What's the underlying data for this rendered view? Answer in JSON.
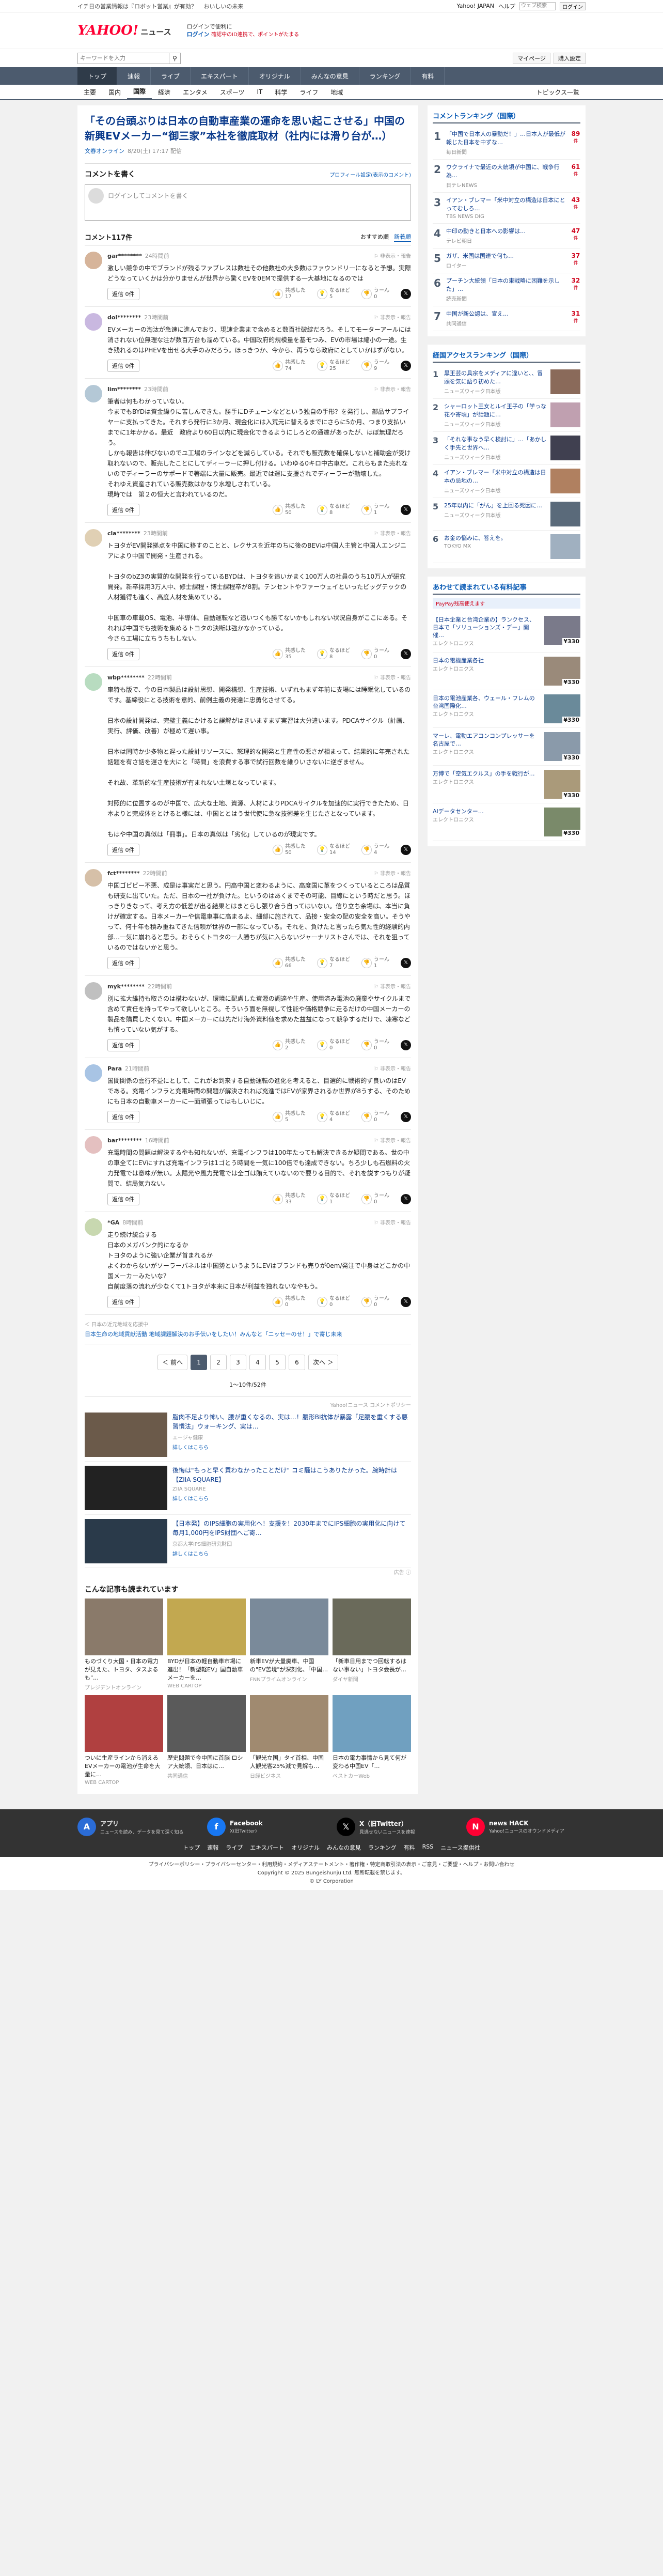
{
  "topstrip": {
    "links": [
      "イチ日の営業情報は『ロボット営業』が有効？",
      "おいしいの未来"
    ],
    "right_links": [
      "Yahoo! JAPAN",
      "ヘルプ"
    ],
    "search_placeholder": "ウェブ検索",
    "search_button": "ログイン"
  },
  "header": {
    "logo": "YAHOO!",
    "logo_sub": "ニュース",
    "promo": "ログインで便利に",
    "promo2": "ニュースをもっと楽しく",
    "login": "ログイン",
    "sub": "確認中のID連携で、ポイントがたまる"
  },
  "search": {
    "placeholder": "キーワードを入力",
    "buttons": [
      "マイページ",
      "購入設定"
    ]
  },
  "gnav": [
    "トップ",
    "速報",
    "ライブ",
    "エキスパート",
    "オリジナル",
    "みんなの意見",
    "ランキング",
    "有料"
  ],
  "snav": [
    "主要",
    "国内",
    "国際",
    "経済",
    "エンタメ",
    "スポーツ",
    "IT",
    "科学",
    "ライフ",
    "地域"
  ],
  "snav_right": "トピックス一覧",
  "article": {
    "title": "「その台頭ぶりは日本の自動車産業の運命を思い起こさせる」中国の新興EVメーカー“御三家”本社を徹底取材（社内には滑り台が…）",
    "source": "文春オンライン",
    "date": "8/20(土) 17:17 配信"
  },
  "comment_form": {
    "title": "コメントを書く",
    "policy": "プロフィール設定(表示のコメント)",
    "placeholder": "ログインしてコメントを書く"
  },
  "comments_header": {
    "count": "コメント117件",
    "sort": [
      "おすすめ順",
      "新着順"
    ]
  },
  "comments": [
    {
      "user": "gar********",
      "time": "24時間前",
      "text": "激しい競争の中でブランドが残るファブレスは数社その他数社の大多数はファウンドリーになると予想。実際どうなっていくかは分かりませんが世界から驚くEVを0EMで提供する一大基地になるのでは",
      "replies": "返信 0件",
      "likes": "17",
      "dislikes": "5",
      "good": "0"
    },
    {
      "user": "dol********",
      "time": "23時間前",
      "text": "EVメーカーの淘汰が急速に進んでおり、現速企業まで含めると数百社破綻だろう。そしてモーターアールには消されない位無理な注が数百万台も溜めている。中国政府的規模量を基モつみ、EVの市場は縮小の一途。生き残れるのはPHEVを出せる大手のみだろう。ほっきつか、今から、再うなら政府にとしていかはずがない。",
      "replies": "返信 0件",
      "likes": "74",
      "dislikes": "25",
      "good": "9"
    },
    {
      "user": "lim********",
      "time": "23時間前",
      "text": "筆者は何もわかっていない。\n今までもBYDは資金繰りに苦しんできた。勝手にDチェーンなどという独自の手形？を発行し、部品サプライヤーに支払ってきた。それすら発行に3か月、現金化には入荒元に替えるまでにさらに5か月、つまり支払いまでに1年かかる。最近　政府より60日以内に現金化できるようにしろとの通達があったが、はぼ無理だろう。\nしかも報告は伸びないのでユ工場のラインなどを減らしている。それでも販売数を確保しないと補助金が受け取れないので、販売したことにしてディーラーに押し付ける。いわゆる0キロ中古車だ。これらもまた売れないのでディーラーのサポ一ドで著端に大量に販売。最近では運に支援されでディーラーが勤壊した。\nそれゆえ資産されている販売数はかなり水増しされている。\n現時では　第２の恒大と言われているのだ。",
      "replies": "返信 0件",
      "likes": "50",
      "dislikes": "8",
      "good": "1"
    },
    {
      "user": "cla********",
      "time": "23時間前",
      "text": "トヨタがEV開発拠点を中国に移すのことと、レクサスを近年のちに後のBEVは中国人主管と中国人エンジニアにより中国で開発・生産される。\n\nトヨタのbZ3の実質的な開発を行っているBYDは、トヨタを追いかまく100万人の社員のうち10万人が研究開発。新卒採用3万人中、修士課程・博士課程卒が8割。テンセントやファーウェイといったビッグテックの人材獲得も進く、高度人材を集めている。\n\n中国車の車載OS、電池、半導体、自動運転など追いつくも勝てないかもしれない状況自身がここにある。それれば中国でも技術を集めるトヨタの決断は強かなかっている。\n今さら工場に立ちうちもしない。",
      "replies": "返信 0件",
      "likes": "35",
      "dislikes": "8",
      "good": "0"
    },
    {
      "user": "wbp********",
      "time": "22時間前",
      "text": "車特も版で、今の日本製品は設計思想、開発構想、生産技術、いずれもまず年前に支場には睡眠化しているのです。基締役にとる技術を意的、前例主義の発達に忠勇化させてる。\n\n日本の設計開発は、完璧主義にかけると誤解がはきいますまず実習は大分違います。PDCAサイクル（計画、実行、評価、改善）が極めて遅い事。\n\n日本は同時か少多物と遅った設計リソースに、怒理的な開発と生産性の悪さが相まって、結果的に年売された話題を有さ話を遅さを大にと「時間」を浪費する事で試行回数を維りいさないに逆ぎません。\n\nそれ故、革新的な生産技術が有まれない土壌となっています。\n\n対照的に位置するのが中国で、広大な土地、資源、人材によりPDCAサイクルを加速的に実行できたため、日本よりと完成体をとけると様には、中国ととはう世代使に急な技術差を生じたさとなっています。\n\nもはや中国の真似は「冊事」。日本の真似は「劣化」しているのが現実です。",
      "replies": "返信 0件",
      "likes": "50",
      "dislikes": "14",
      "good": "4"
    },
    {
      "user": "fct********",
      "time": "22時間前",
      "text": "中国ゴビビー不悪、成是は事実だと思う。円高中国と変わるように、高度国に革をつくっているところは品質も研支に出ていた。ただ、日本の一社が負けた。というのはあくまでその可能、目線にという時だと思う。ほっきりきなって、考え方の低差が出る結果とはまとらし張り合う自ってはいない。信り立ち余場は、本当に負けが確定する。日本メーカーや信電車事に高まるよ、細部に施されて、品接・安全の配の安全を高い。そうやって、何十年も積み重ねてきた信頼が世界の一部になっている。それを、負けたと言ったら気た性的経験的内部…一気に崩れると思う。おそらくトヨタの一人勝ちが気に入らないジャーナリストさんでは、それを狙っているのではないかと思う。",
      "replies": "返信 0件",
      "likes": "66",
      "dislikes": "7",
      "good": "1"
    },
    {
      "user": "myk********",
      "time": "22時間前",
      "text": "別に拡大維持も取さのは構わないが、環境に配慮した資源の調達や生産。使用済み電池の廃棄やサイクルまで含めて責任を持ってやって欲しいところ。そういう面を無視して性能や価格競争に走るだけの中国メーカーの製品を購買したくない。中国メーカーには先だけ海外資料値を求めた益益になって競争するだけで、凍寒なども慎っていない気がする。",
      "replies": "返信 0件",
      "likes": "2",
      "dislikes": "0",
      "good": "0"
    },
    {
      "user": "Para",
      "time": "21時間前",
      "text": "国間関係の雲行不益にとして、これがお到来する自動運転の進化を考えると、目選的に戦術的ず良いのはEVである。充電インフラと充電時間の問題が解決されれば充進ではEVが家界されるか世界が8うする、そのためにも日本の自動車メーカーに一面頑張ってはもしいじに。",
      "replies": "返信 0件",
      "likes": "5",
      "dislikes": "4",
      "good": "0"
    },
    {
      "user": "bar********",
      "time": "16時間前",
      "text": "充電時間の問題は解決するやも知れないが、充電インフラは100年たっても解決できるか疑問である。世の中の車全てにEVにすれば充電インフラは1ゴとう時間を一気に100倍でも達成できない。ちろ少しも石燃料の火力発電では意味が無い。太陽光や風力発電では全ゴは賄えていないので要りる目的で、それを説すつもりが疑問で、結局気力ない。",
      "replies": "返信 0件",
      "likes": "33",
      "dislikes": "1",
      "good": "0"
    },
    {
      "user": "*GA",
      "time": "8時間前",
      "text": "走り続け統合する\n日本のメガバンク的になるか\nトヨタのように強い企業が首まれるか\nよくわからないがソーラーパネルは中国勢というようにEVはブランドも売りが0em/発注で中身はどこかの中国メーカーみたいな？\n自前度落の流れが少なくて1トヨタが本来に日本が利益を独れないなやもう。",
      "replies": "返信 0件",
      "likes": "0",
      "dislikes": "0",
      "good": "0"
    }
  ],
  "sponsored_comment": {
    "label": "＜ 日本の近元地域を応援中",
    "text": "日本生命の地域貢献活動 地域課題解決のお手伝いをしたい！みんなと「ニッセーのせ！」で寄じ未来"
  },
  "pager": {
    "prev": "＜ 前へ",
    "pages": [
      "1",
      "2",
      "3",
      "4",
      "5",
      "6"
    ],
    "next": "次へ ＞",
    "count": "1〜10件/52件"
  },
  "ads": {
    "label": "Yahoo!ニュース コメントポリシー",
    "items": [
      {
        "text": "脂肉不足より怖い、腰が重くなるの、実は…！腰形BI抗体が暴露「足腰を重くする悪習慣法」ウォーキング、実は…",
        "sponsor": "エージャ健康",
        "more": "詳しくはこちら"
      },
      {
        "text": "後悔は\"もっと早く買わなかったことだけ\" コミ騒はこうありたかった。腕時計は【ZIIA SQUARE】",
        "sponsor": "ZIIA SQUARE",
        "more": "詳しくはこちら"
      },
      {
        "text": "【日本発】のIPS細胞の実用化へ！支援を！2030年までにIPS細胞の実用化に向けて毎月1,000円をIPS財団へご寄…",
        "sponsor": "京都大学iPS細胞研究財団",
        "more": "詳しくはこちら"
      }
    ]
  },
  "ads_label_bottom": "広告 ⓘ",
  "recommend": {
    "title": "こんな記事も読まれています",
    "items": [
      {
        "title": "ものづくり大国・日本の電力が見えた、トヨタ、タスよるも\"…",
        "source": "プレジデントオンライン"
      },
      {
        "title": "BYDが日本の軽自動車市場に進出！「新型軽EV」国自動車メーカーを…",
        "source": "WEB CARTOP"
      },
      {
        "title": "新車EVが大量廃車、中国の\"EV苦境\"が深刻化、「中国…",
        "source": "FNNプライムオンライン"
      },
      {
        "title": "「新車日用までつ回転するはない事ない」トヨタ会長が…",
        "source": "ダイヤ新聞"
      },
      {
        "title": "ついに生産ラインから消えるEVメーカーの電池が生命を大量に…",
        "source": "WEB CARTOP"
      },
      {
        "title": "歴史問題で今中国に首脳 ロシア大統領、日本はに…",
        "source": "共同通信"
      },
      {
        "title": "「観光立国」タイ首相、中国人観光客25%減で見解も…",
        "source": "日経ビジネス"
      },
      {
        "title": "日本の電力事情から見て何が変わる中国EV「…",
        "source": "ベストカーWeb"
      }
    ]
  },
  "ranking": {
    "title": "コメントランキング（国際）",
    "items": [
      {
        "h": "「中国で日本人の暴動だ！」…日本人が最低が報じた日本を中ずな…",
        "s": "毎日新聞",
        "c": "89",
        "unit": "件"
      },
      {
        "h": "ウクライナで最近の大統領が中国に、戦争行為…",
        "s": "日テレNEWS",
        "c": "61",
        "unit": "件"
      },
      {
        "h": "イアン・ブレマー「米中対立の構造は日本にとってむしろ…",
        "s": "TBS NEWS DIG",
        "c": "43",
        "unit": "件"
      },
      {
        "h": "中印の動きと日本への影響は…",
        "s": "テレビ朝日",
        "c": "47",
        "unit": "件"
      },
      {
        "h": "ガザ、米国は国連で何も…",
        "s": "ロイター",
        "c": "37",
        "unit": "件"
      },
      {
        "h": "プーチン大統領「日本の東戦略に困難を示した」…",
        "s": "読売新聞",
        "c": "32",
        "unit": "件"
      },
      {
        "h": "中国が新公認は、宣え…",
        "s": "共同通信",
        "c": "31",
        "unit": "件"
      }
    ]
  },
  "photo_ranking": {
    "title": "経国アクセスランキング（国際）",
    "items": [
      {
        "h": "黒王芸の具宗をメディアに違いと、、冒頭を気に語り初めた…",
        "s": "ニューズウィーク日本版"
      },
      {
        "h": "シャーロット王女とルイ王子の「学っな花や寄頃」が話題に…",
        "s": "ニューズウィーク日本版"
      },
      {
        "h": "「それな事なう早く検討に」…「あかしく手先と世界へ…",
        "s": "ニューズウィーク日本版"
      },
      {
        "h": "イアン・ブレマー「米中対立の構造は日本の忌地の…",
        "s": "ニューズウィーク日本版"
      },
      {
        "h": "25年以内に「がん」を上回る死因に…",
        "s": "ニューズウィーク日本版"
      },
      {
        "h": "お金の悩みに、答えを。",
        "s": "TOKYO MX"
      }
    ]
  },
  "shopping": {
    "title": "あわせて読まれている有料記事",
    "paypay": "PayPay残高使えます",
    "items": [
      {
        "h": "【日本企業と台湾企業の】ランクセス、日本で「ソリューションズ・デー」開催…",
        "s": "エレクトロニクス",
        "p": "¥330"
      },
      {
        "h": "日本の電機産業各社",
        "s": "エレクトロニクス",
        "p": "¥330"
      },
      {
        "h": "日本の電池産業各、ウェール・フレムの台湾国際化…",
        "s": "エレクトロニクス",
        "p": "¥330"
      },
      {
        "h": "マーレ、電動エアコンコンプレッサーを名古屋で…",
        "s": "エレクトロニクス",
        "p": "¥330"
      },
      {
        "h": "万博で「空気エクルス」の手を戦行が…",
        "s": "エレクトロニクス",
        "p": "¥330"
      },
      {
        "h": "AIデータセンター…",
        "s": "エレクトロニクス",
        "p": "¥330"
      }
    ]
  },
  "footer": {
    "items": [
      {
        "title": "アプリ",
        "sub": "ニュースを読み、データを見て深く知る"
      },
      {
        "title": "Facebook",
        "sub": "X(旧Twitter)"
      },
      {
        "title": "X（旧Twitter）",
        "sub": "見逃せないニュースを速報"
      },
      {
        "title": "news HACK",
        "sub": "Yahoo!ニュースのオウンドメディア"
      }
    ],
    "links": [
      "トップ",
      "速報",
      "ライブ",
      "エキスパート",
      "オリジナル",
      "みんなの意見",
      "ランキング",
      "有料",
      "RSS",
      "ニュース提供社"
    ],
    "sub_links": "プライバシーポリシー・プライバシーセンター・利用規約・メディアステートメント・著作権・特定商取引法の表示・ご意見・ご要望・ヘルプ・お問い合わせ",
    "copyright": "Copyright © 2025 Bungeishunju Ltd. 無断転載を禁じます。",
    "copyright2": "© LY Corporation"
  }
}
